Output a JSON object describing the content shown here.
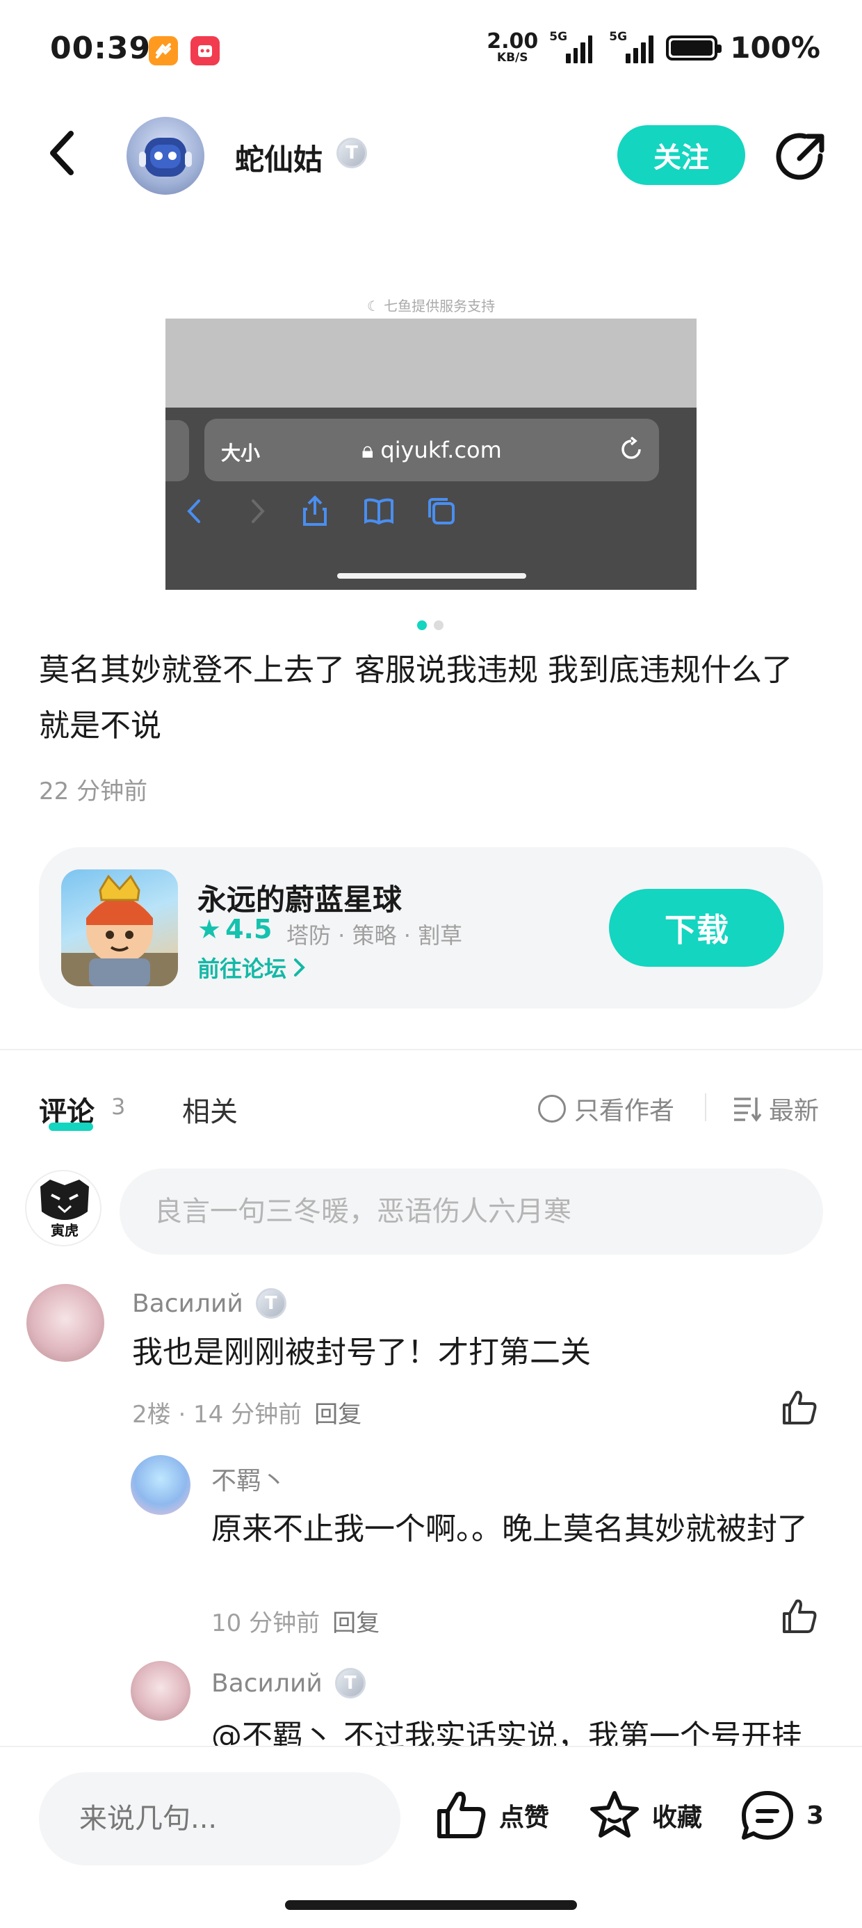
{
  "status_bar": {
    "time": "00:39",
    "net_speed_value": "2.00",
    "net_speed_unit": "KB/S",
    "sim1": "5G",
    "sim2": "5G",
    "battery": "100%"
  },
  "header": {
    "user_name": "蛇仙姑",
    "level": "T",
    "follow_label": "关注"
  },
  "post": {
    "image_caption": "七鱼提供服务支持",
    "image_size_text": "大小",
    "image_url": "qiyukf.com",
    "image_count": 2,
    "image_index": 1,
    "text": "莫名其妙就登不上去了 客服说我违规 我到底违规什么了 就是不说",
    "time": "22 分钟前"
  },
  "game": {
    "title": "永远的蔚蓝星球",
    "rating": "4.5",
    "tags": "塔防 · 策略 · 割草",
    "forum_link": "前往论坛",
    "download_label": "下载"
  },
  "tabs": {
    "comments_label": "评论",
    "comments_count": "3",
    "related_label": "相关",
    "author_only_label": "只看作者",
    "sort_label": "最新"
  },
  "compose": {
    "placeholder": "良言一句三冬暖，恶语伤人六月寒",
    "my_avatar_text": "寅虎"
  },
  "comments": [
    {
      "name": "Василий",
      "level": "T",
      "text": "我也是刚刚被封号了！才打第二关",
      "meta": "2楼 · 14 分钟前",
      "reply": "回复"
    }
  ],
  "replies": [
    {
      "name": "不羁丶",
      "text": "原来不止我一个啊。。晚上莫名其妙就被封了",
      "meta": "10 分钟前",
      "reply": "回复"
    },
    {
      "name": "Василий",
      "level": "T",
      "text": "@不羁丶  不过我实话实说，我第一个号开挂"
    }
  ],
  "bottom_bar": {
    "input_placeholder": "来说几句...",
    "like_label": "点赞",
    "collect_label": "收藏",
    "comment_count": "3"
  },
  "colors": {
    "accent": "#14d5c0",
    "accent_text": "#14b8a6",
    "muted": "#999999"
  }
}
